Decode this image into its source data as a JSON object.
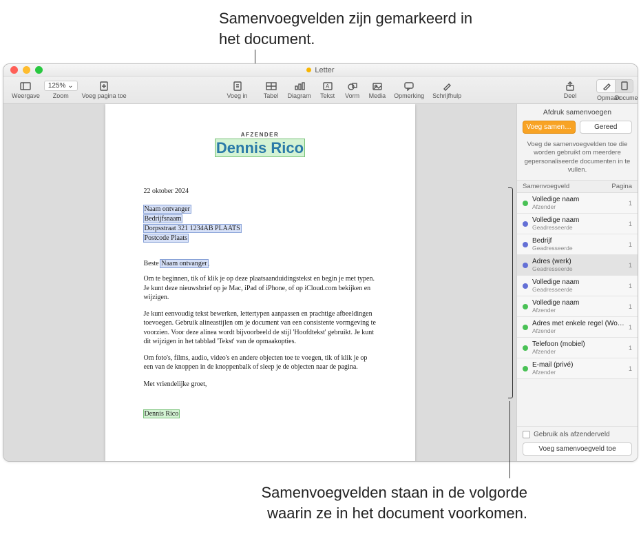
{
  "callouts": {
    "top": "Samenvoegvelden zijn gemarkeerd in het document.",
    "bottom": "Samenvoegvelden staan in de volgorde waarin ze in het document voorkomen."
  },
  "window": {
    "title": "Letter"
  },
  "toolbar": {
    "weergave": "Weergave",
    "zoom_label": "Zoom",
    "zoom_value": "125% ⌄",
    "voeg_pagina": "Voeg pagina toe",
    "voeg_in": "Voeg in",
    "tabel": "Tabel",
    "diagram": "Diagram",
    "tekst": "Tekst",
    "vorm": "Vorm",
    "media": "Media",
    "opmerking": "Opmerking",
    "schrijfhulp": "Schrijfhulp",
    "deel": "Deel",
    "opmaak": "Opmaak",
    "document": "Document"
  },
  "doc": {
    "sender_label": "AFZENDER",
    "sender_name": "Dennis Rico",
    "date": "22 oktober 2024",
    "addr1": "Naam ontvanger",
    "addr2": "Bedrijfsnaam",
    "addr3": "Dorpsstraat 321 1234AB PLAATS",
    "addr4": "Postcode Plaats",
    "greeting_prefix": "Beste ",
    "greeting_name": "Naam ontvanger",
    "greeting_suffix": ",",
    "p1a": "Om te beginnen, tik of klik je op deze plaatsaanduidingstekst en begin je met typen.",
    "p1b": "Je kunt deze nieuwsbrief op je Mac, iPad of iPhone, of op iCloud.com bekijken en wijzigen.",
    "p2": "Je kunt eenvoudig tekst bewerken, lettertypen aanpassen en prachtige afbeeldingen toevoegen. Gebruik alineastijlen om je document van een consistente vormgeving te voorzien. Voor deze alinea wordt bijvoorbeeld de stijl 'Hoofdtekst' gebruikt. Je kunt dit wijzigen in het tabblad 'Tekst' van de opmaakopties.",
    "p3": "Om foto's, films, audio, video's en andere objecten toe te voegen, tik of klik je op een van de knoppen in de knoppenbalk of sleep je de objecten naar de pagina.",
    "signoff": "Met vriendelijke groet,",
    "signature": "Dennis Rico"
  },
  "sidebar": {
    "title": "Afdruk samenvoegen",
    "merge_btn": "Voeg samen…",
    "done_btn": "Gereed",
    "help": "Voeg de samenvoegvelden toe die worden gebruikt om meerdere gepersonaliseerde documenten in te vullen.",
    "col_field": "Samenvoegveld",
    "col_page": "Pagina",
    "rows": [
      {
        "color": "green",
        "name": "Volledige naam",
        "sub": "Afzender",
        "page": "1"
      },
      {
        "color": "blue",
        "name": "Volledige naam",
        "sub": "Geadresseerde",
        "page": "1"
      },
      {
        "color": "blue",
        "name": "Bedrijf",
        "sub": "Geadresseerde",
        "page": "1"
      },
      {
        "color": "blue",
        "name": "Adres (werk)",
        "sub": "Geadresseerde",
        "page": "1",
        "selected": true
      },
      {
        "color": "blue",
        "name": "Volledige naam",
        "sub": "Geadresseerde",
        "page": "1"
      },
      {
        "color": "green",
        "name": "Volledige naam",
        "sub": "Afzender",
        "page": "1"
      },
      {
        "color": "green",
        "name": "Adres met enkele regel (Woning)",
        "sub": "Afzender",
        "page": "1"
      },
      {
        "color": "green",
        "name": "Telefoon (mobiel)",
        "sub": "Afzender",
        "page": "1"
      },
      {
        "color": "green",
        "name": "E-mail (privé)",
        "sub": "Afzender",
        "page": "1"
      }
    ],
    "use_as_sender": "Gebruik als afzenderveld",
    "add_field": "Voeg samenvoegveld toe"
  }
}
